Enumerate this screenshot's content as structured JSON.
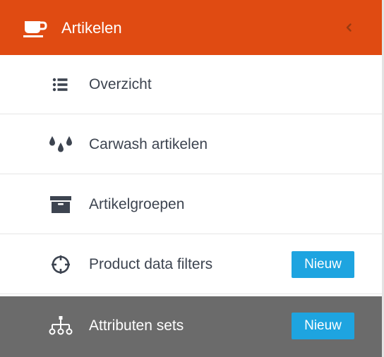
{
  "colors": {
    "accent": "#e04b12",
    "active_background": "#6b6b6b",
    "badge": "#1ea4e0",
    "text": "#3d4450"
  },
  "header": {
    "title": "Artikelen",
    "icon": "coffee-cup-icon",
    "collapse_icon": "chevron-left-icon"
  },
  "items": [
    {
      "label": "Overzicht",
      "icon": "list-icon",
      "badge": null,
      "active": false
    },
    {
      "label": "Carwash artikelen",
      "icon": "water-drops-icon",
      "badge": null,
      "active": false
    },
    {
      "label": "Artikelgroepen",
      "icon": "archive-box-icon",
      "badge": null,
      "active": false
    },
    {
      "label": "Product data filters",
      "icon": "crosshairs-icon",
      "badge": "Nieuw",
      "active": false
    },
    {
      "label": "Attributen sets",
      "icon": "sitemap-icon",
      "badge": "Nieuw",
      "active": true
    }
  ]
}
